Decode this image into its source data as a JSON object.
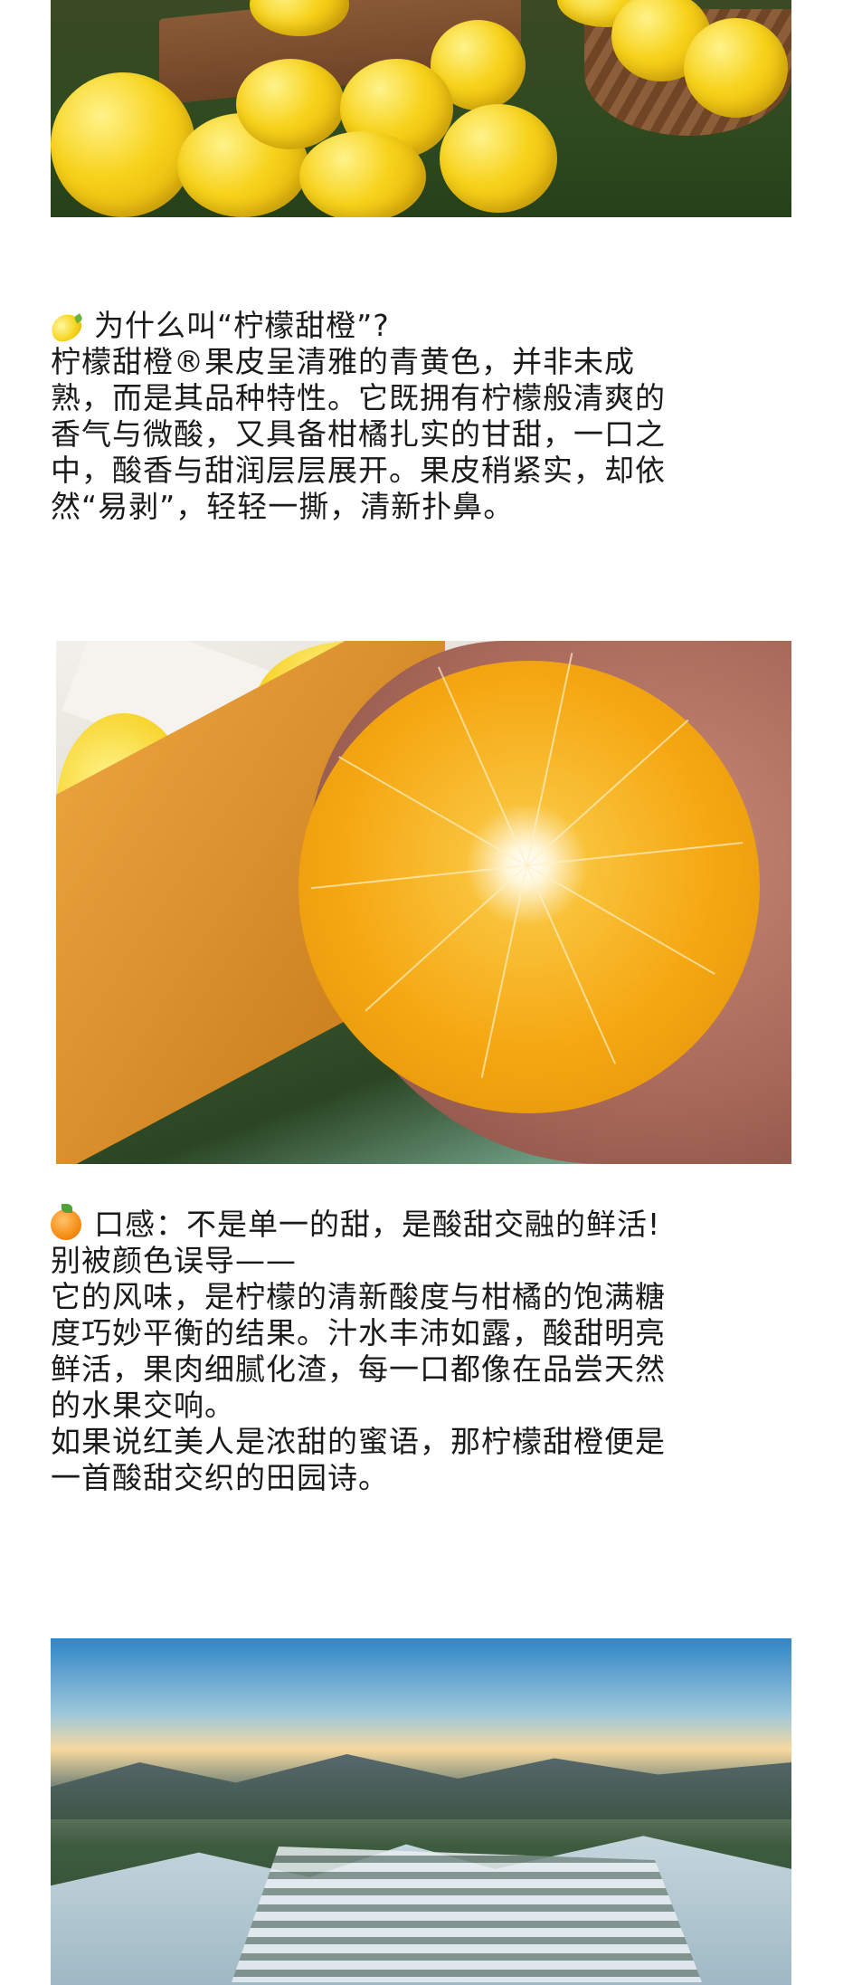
{
  "section1": {
    "heading": "为什么叫“柠檬甜橙”?",
    "heading_icon": "lemon-emoji",
    "lines": [
      "柠檬甜橙®果皮呈清雅的青黄色，并非未成",
      "熟，而是其品种特性。它既拥有柠檬般清爽的",
      "香气与微酸，又具备柑橘扎实的甘甜，一口之",
      "中，酸香与甜润层层展开。果皮稍紧实，却依",
      "然“易剥”，轻轻一撕，清新扑鼻。"
    ]
  },
  "section2": {
    "heading": "口感：不是单一的甜，是酸甜交融的鲜活!",
    "heading_icon": "tangerine-emoji",
    "lines": [
      "别被颜色误导——",
      "它的风味，是柠檬的清新酸度与柑橘的饱满糖",
      "度巧妙平衡的结果。汁水丰沛如露，酸甜明亮",
      "鲜活，果肉细腻化渣，每一口都像在品尝天然",
      "的水果交响。",
      "如果说红美人是浓甜的蜜语，那柠檬甜橙便是",
      "一首酸甜交织的田园诗。"
    ]
  },
  "colors": {
    "text": "#1a1a1a",
    "background": "#ffffff"
  }
}
